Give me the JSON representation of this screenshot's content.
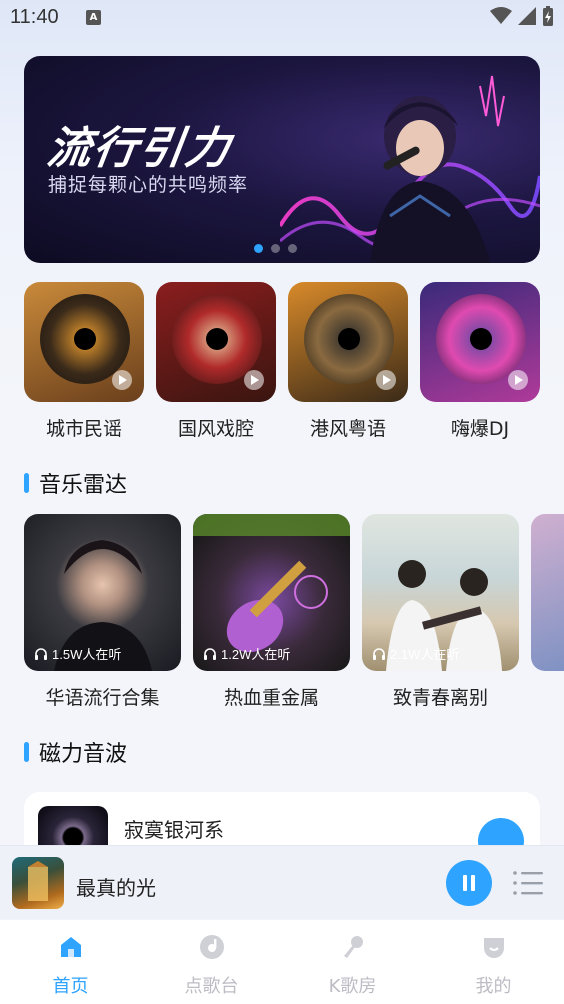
{
  "status_bar": {
    "time": "11:40",
    "indicator": "A"
  },
  "banner": {
    "title": "流行引力",
    "subtitle": "捕捉每颗心的共鸣频率",
    "dots": 3,
    "active_dot": 0
  },
  "categories": [
    {
      "label": "城市民谣",
      "icon": "guitar-disc"
    },
    {
      "label": "国风戏腔",
      "icon": "opera-disc"
    },
    {
      "label": "港风粤语",
      "icon": "retro-disc"
    },
    {
      "label": "嗨爆DJ",
      "icon": "dj-disc"
    }
  ],
  "radar": {
    "title": "音乐雷达",
    "items": [
      {
        "label": "华语流行合集",
        "listeners": "1.5W人在听"
      },
      {
        "label": "热血重金属",
        "listeners": "1.2W人在听"
      },
      {
        "label": "致青春离别",
        "listeners": "2.1W人在听"
      }
    ]
  },
  "magnetic": {
    "title": "磁力音波",
    "items": [
      {
        "title": "寂寞银河系"
      }
    ]
  },
  "player": {
    "title": "最真的光",
    "state": "playing"
  },
  "tabs": [
    {
      "label": "首页",
      "icon": "home-icon",
      "active": true
    },
    {
      "label": "点歌台",
      "icon": "music-disc-icon",
      "active": false
    },
    {
      "label": "K歌房",
      "icon": "microphone-icon",
      "active": false
    },
    {
      "label": "我的",
      "icon": "profile-icon",
      "active": false
    }
  ],
  "colors": {
    "accent": "#2ea3ff",
    "inactive": "#bcbcc4"
  }
}
